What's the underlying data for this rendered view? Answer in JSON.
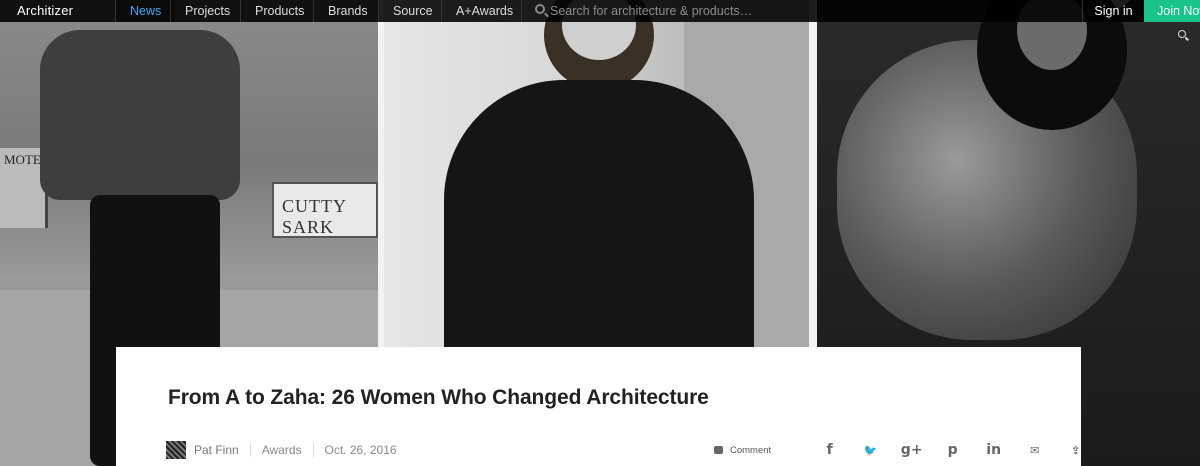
{
  "nav": {
    "logo": "Architizer",
    "items": [
      {
        "label": "News",
        "active": true
      },
      {
        "label": "Projects",
        "active": false
      },
      {
        "label": "Products",
        "active": false
      },
      {
        "label": "Brands",
        "active": false
      },
      {
        "label": "Source",
        "active": false
      },
      {
        "label": "A+Awards",
        "active": false
      }
    ],
    "search_placeholder": "Search for architecture & products…",
    "sign_in": "Sign in",
    "join": "Join Now"
  },
  "hero": {
    "billboard_text": "CUTTY SARK",
    "motel_sign": "MOTEL"
  },
  "article": {
    "title": "From A to Zaha: 26 Women Who Changed Architecture",
    "author": "Pat Finn",
    "category": "Awards",
    "date": "Oct. 26, 2016",
    "comment_label": "Comment",
    "share_icons": [
      {
        "name": "facebook-icon",
        "glyph": "f"
      },
      {
        "name": "twitter-icon",
        "glyph": "🐦"
      },
      {
        "name": "google-plus-icon",
        "glyph": "g+"
      },
      {
        "name": "pinterest-icon",
        "glyph": "p"
      },
      {
        "name": "linkedin-icon",
        "glyph": "in"
      },
      {
        "name": "email-icon",
        "glyph": "✉"
      },
      {
        "name": "share-icon",
        "glyph": "⇪"
      }
    ]
  },
  "colors": {
    "accent_active": "#3fa9f5",
    "join_button": "#18c48a"
  }
}
